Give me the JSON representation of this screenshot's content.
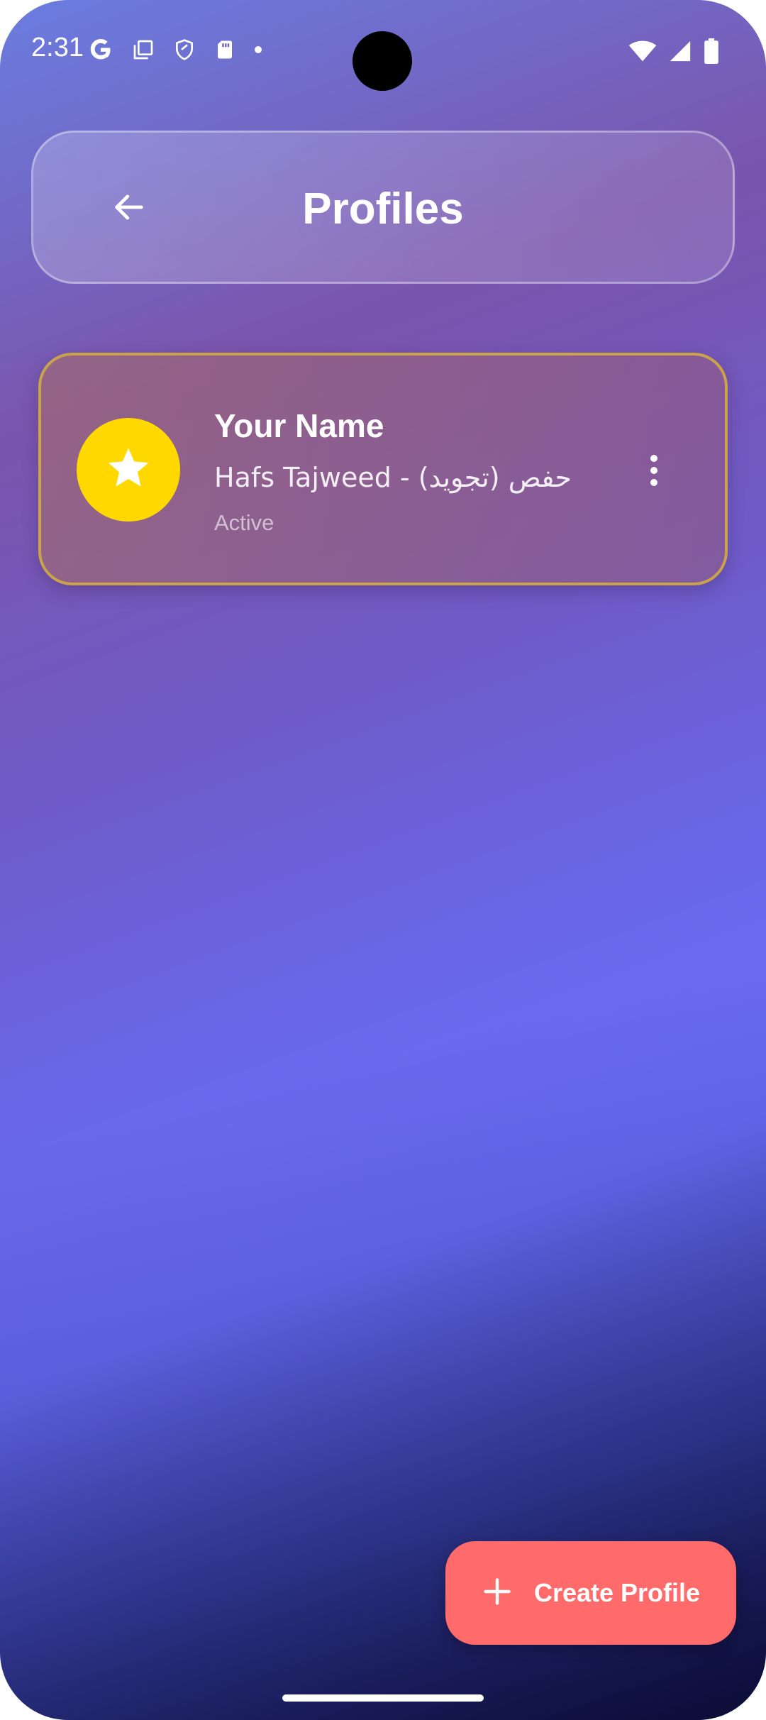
{
  "status_bar": {
    "time": "2:31",
    "left_icons": [
      "google-icon",
      "copy-icon",
      "shield-icon",
      "sd-card-icon",
      "dot-icon"
    ],
    "right_icons": [
      "wifi-icon",
      "signal-icon",
      "battery-icon"
    ]
  },
  "header": {
    "title": "Profiles",
    "back_icon": "arrow-left-icon"
  },
  "profiles": [
    {
      "name": "Your Name",
      "subtitle": "حفص (تجويد) - Hafs Tajweed",
      "status": "Active",
      "avatar_icon": "star-icon",
      "avatar_color": "#FFD800",
      "border_color": "#C9A24A"
    }
  ],
  "fab": {
    "label": "Create Profile",
    "icon": "plus-icon",
    "color": "#FF6B6B"
  }
}
